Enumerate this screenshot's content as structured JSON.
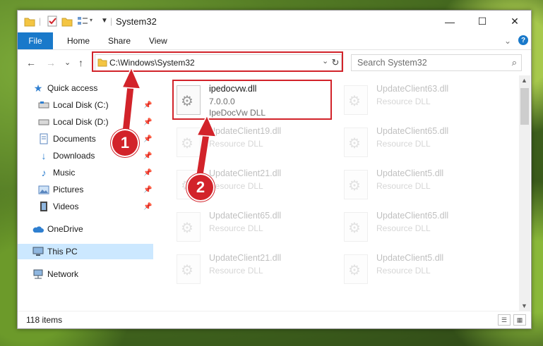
{
  "window": {
    "title": "System32",
    "controls": {
      "minimize": "—",
      "maximize": "☐",
      "close": "✕"
    }
  },
  "ribbon": {
    "tabs": [
      "File",
      "Home",
      "Share",
      "View"
    ],
    "expand": "⌄",
    "help": "?"
  },
  "nav": {
    "back": "←",
    "forward": "→",
    "recent": "⌄",
    "up": "↑",
    "address": "C:\\Windows\\System32",
    "address_chevron": "⌄",
    "refresh": "↻",
    "search_placeholder": "Search System32"
  },
  "sidebar": {
    "items": [
      {
        "label": "Quick access",
        "icon": "star-icon",
        "pinned": false
      },
      {
        "label": "Local Disk (C:)",
        "icon": "drive-icon",
        "pinned": true
      },
      {
        "label": "Local Disk (D:)",
        "icon": "drive-icon",
        "pinned": true
      },
      {
        "label": "Documents",
        "icon": "documents-icon",
        "pinned": true
      },
      {
        "label": "Downloads",
        "icon": "download-icon",
        "pinned": true
      },
      {
        "label": "Music",
        "icon": "music-icon",
        "pinned": true
      },
      {
        "label": "Pictures",
        "icon": "pictures-icon",
        "pinned": true
      },
      {
        "label": "Videos",
        "icon": "videos-icon",
        "pinned": true
      },
      {
        "label": "OneDrive",
        "icon": "cloud-icon",
        "pinned": false
      },
      {
        "label": "This PC",
        "icon": "computer-icon",
        "pinned": false,
        "selected": true
      },
      {
        "label": "Network",
        "icon": "network-icon",
        "pinned": false
      }
    ]
  },
  "files": {
    "main": {
      "name": "ipedocvw.dll",
      "version": "7.0.0.0",
      "description": "IpeDocVw DLL"
    },
    "background": [
      {
        "name": "UpdateClient63.dll",
        "description": "Resource DLL"
      },
      {
        "name": "UpdateClient19.dll",
        "description": "Resource DLL"
      },
      {
        "name": "UpdateClient65.dll",
        "description": "Resource DLL"
      },
      {
        "name": "UpdateClient21.dll",
        "description": "Resource DLL"
      },
      {
        "name": "UpdateClient5.dll",
        "description": "Resource DLL"
      },
      {
        "name": "UpdateClient65.dll",
        "description": "Resource DLL"
      },
      {
        "name": "UpdateClient65.dll",
        "description": "Resource DLL"
      },
      {
        "name": "UpdateClient21.dll",
        "description": "Resource DLL"
      },
      {
        "name": "UpdateClient5.dll",
        "description": "Resource DLL"
      }
    ]
  },
  "status": {
    "item_count": "118 items"
  },
  "callouts": [
    "1",
    "2"
  ],
  "colors": {
    "accent": "#1979ca",
    "highlight": "#d2232a",
    "selection": "#cce8ff"
  }
}
